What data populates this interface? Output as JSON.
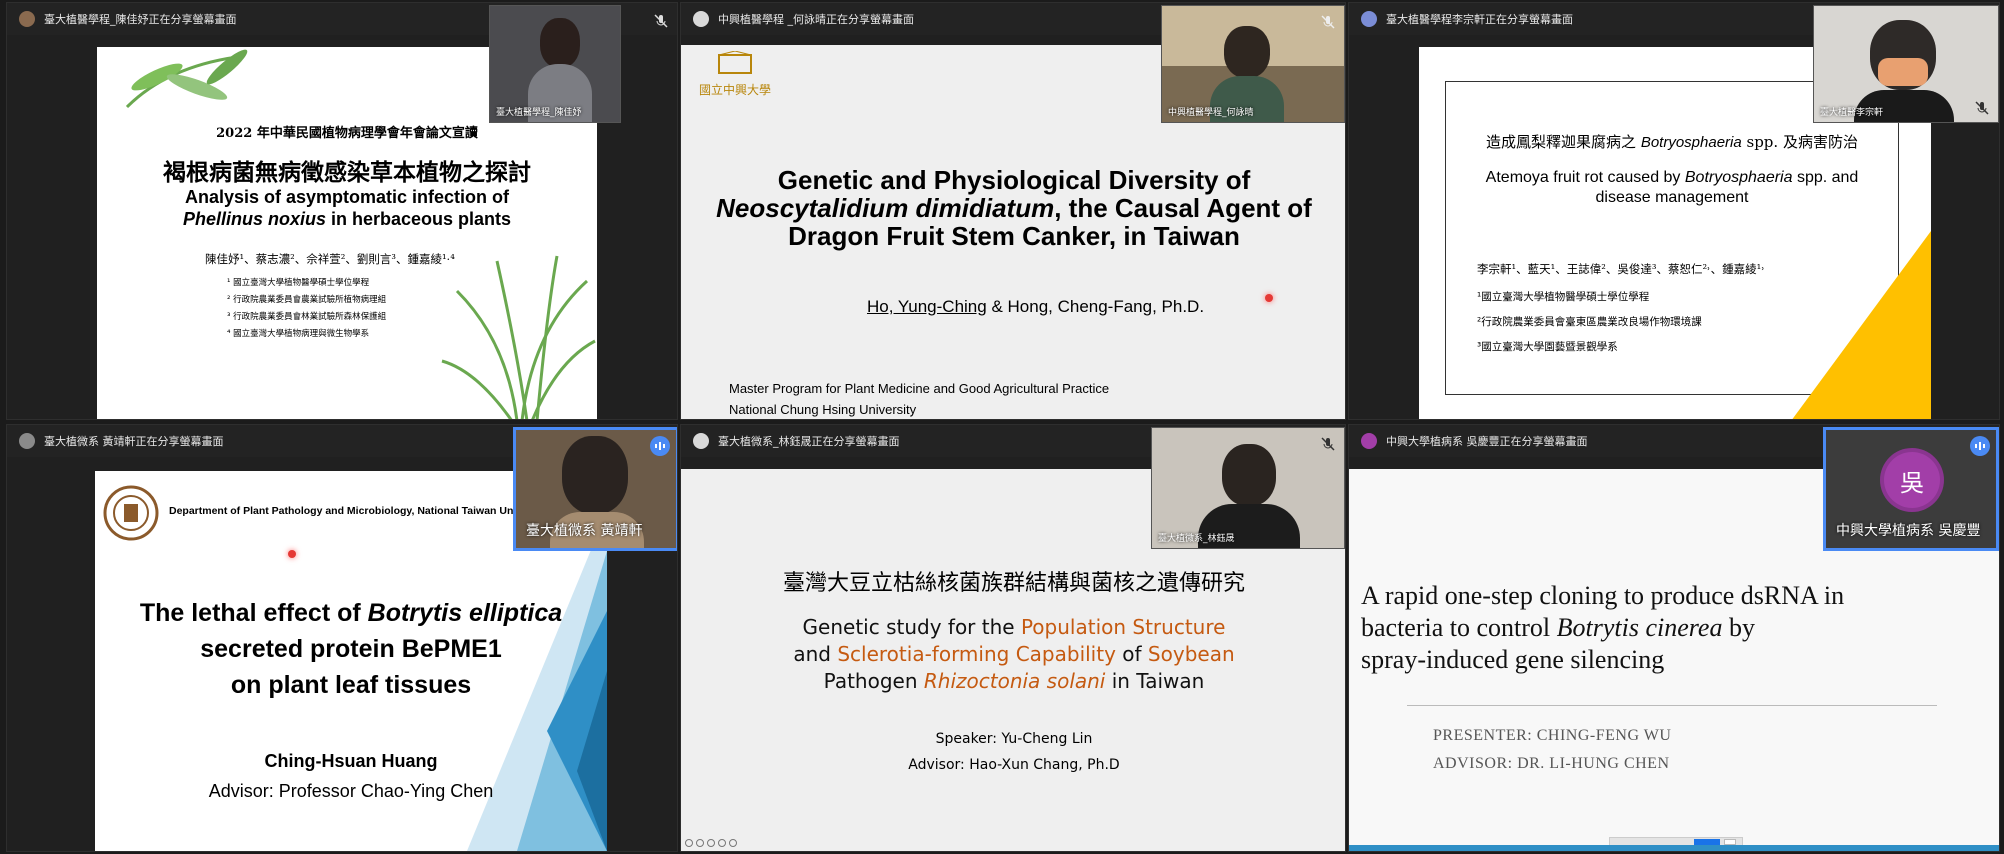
{
  "tiles": [
    {
      "share_text": "臺大植醫學程_陳佳妤正在分享螢幕畫面",
      "pip_name": "臺大植醫學程_陳佳妤",
      "slide": {
        "conference": "2022 年中華民國植物病理學會年會論文宣讀",
        "title_zh": "褐根病菌無病徵感染草本植物之探討",
        "title_en_1": "Analysis of asymptomatic infection of",
        "title_en_2a": "Phellinus noxius",
        "title_en_2b": " in herbaceous plants",
        "authors": "陳佳妤¹、蔡志濃²、佘祥萱²、劉則言³、鍾嘉綾¹·⁴",
        "affiliations": [
          "¹ 國立臺灣大學植物醫學碩士學位學程",
          "² 行政院農業委員會農業試驗所植物病理組",
          "³ 行政院農業委員會林業試驗所森林保護組",
          "⁴ 國立臺灣大學植物病理與微生物學系"
        ]
      }
    },
    {
      "share_text": "中興植醫學程 _何詠晴正在分享螢幕畫面",
      "pip_name": "中興植醫學程_何詠晴",
      "slide": {
        "logo_text": "國立中興大學",
        "title_1": "Genetic and Physiological Diversity of",
        "title_2a": "Neoscytalidium dimidiatum",
        "title_2b": ", the Causal Agent of",
        "title_3": "Dragon Fruit Stem Canker, in Taiwan",
        "author_a": "Ho, Yung-Ching",
        "author_b": " & Hong, Cheng-Fang, Ph.D.",
        "footer_1": "Master Program for Plant Medicine and Good Agricultural Practice",
        "footer_2": "National Chung Hsing University"
      }
    },
    {
      "share_text": "臺大植醫學程李宗軒正在分享螢幕畫面",
      "pip_name": "臺大植醫李宗軒",
      "slide": {
        "title_zh_a": "造成鳳梨釋迦果腐病之 ",
        "title_zh_b": "Botryosphaeria",
        "title_zh_c": " spp. 及病害防治",
        "title_en_1a": "Atemoya fruit rot caused by ",
        "title_en_1b": "Botryosphaeria",
        "title_en_1c": " spp. and",
        "title_en_2": "disease management",
        "authors": "李宗軒¹、藍天¹、王誌偉²、吳俊達³、蔡恕仁²˒、鍾嘉綾¹˒",
        "affiliations": [
          "¹國立臺灣大學植物醫學碩士學位學程",
          "²行政院農業委員會臺東區農業改良場作物環境課",
          "³國立臺灣大學園藝暨景觀學系"
        ]
      }
    },
    {
      "share_text": "臺大植微系 黃靖軒正在分享螢幕畫面",
      "pip_name": "臺大植微系 黃靖軒",
      "slide": {
        "dept": "Department of Plant Pathology and Microbiology, National Taiwan Unive",
        "title_1a": "The lethal effect of ",
        "title_1b": "Botrytis elliptica",
        "title_2": "secreted protein BePME1",
        "title_3": "on plant leaf tissues",
        "presenter": "Ching-Hsuan Huang",
        "advisor": "Advisor: Professor Chao-Ying Chen"
      }
    },
    {
      "share_text": "臺大植微系_林鈺晟正在分享螢幕畫面",
      "pip_name": "臺大植微系_林鈺晟",
      "slide": {
        "title_zh": "臺灣大豆立枯絲核菌族群結構與菌核之遺傳研究",
        "line1a": "Genetic study for the ",
        "line1b": "Population Structure",
        "line2a": "and ",
        "line2b": "Sclerotia-forming Capability",
        "line2c": " of ",
        "line2d": "Soybean",
        "line3a": "Pathogen ",
        "line3b": "Rhizoctonia solani",
        "line3c": " in Taiwan",
        "speaker": "Speaker: Yu-Cheng Lin",
        "advisor": "Advisor: Hao-Xun Chang, Ph.D"
      }
    },
    {
      "share_text": "中興大學植病系 吳慶豐正在分享螢幕畫面",
      "pip_name": "中興大學植病系 吳慶豐",
      "avatar_char": "吳",
      "slide": {
        "title_1": "A rapid one-step cloning to produce dsRNA in",
        "title_2a": "bacteria to control ",
        "title_2b": "Botrytis cinerea",
        "title_2c": " by",
        "title_3": "spray-induced gene silencing",
        "presenter": "PRESENTER: CHING-FENG WU",
        "advisor": "ADVISOR: DR. LI-HUNG CHEN"
      }
    }
  ],
  "colors": {
    "active_border": "#4a8af4",
    "orange": "#c55a11",
    "yellow": "#ffc000",
    "avatar_purple": "#a23ea8"
  }
}
